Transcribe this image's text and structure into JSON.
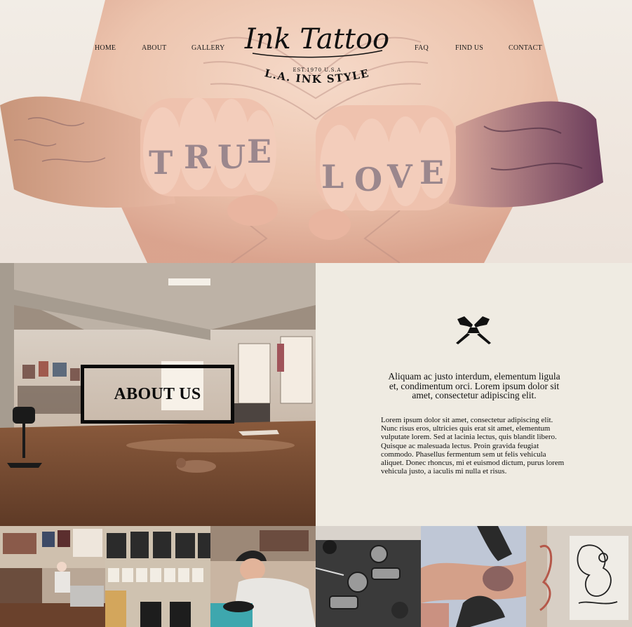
{
  "nav": {
    "left": [
      "HOME",
      "ABOUT",
      "GALLERY"
    ],
    "right": [
      "FAQ",
      "FIND US",
      "CONTACT"
    ]
  },
  "logo": {
    "script": "Ink Tattoo",
    "est": "EST.1970 U.S.A",
    "tagline": "L.A. INK STYLE"
  },
  "hero": {
    "knuckles_left": "TRUE",
    "knuckles_right": "LOVE"
  },
  "about": {
    "title": "ABOUT US",
    "icon": "tattoo-machines-icon",
    "lead": "Aliquam ac justo interdum, elementum ligula et, condimentum orci. Lorem ipsum dolor sit amet, consectetur adipiscing elit.",
    "paragraph1": "Lorem ipsum dolor sit amet, consectetur adipiscing elit. Nunc risus eros, ultricies quis erat sit amet, elementum vulputate lorem. Sed at lacinia lectus, quis blandit libero.",
    "paragraph2": "Quisque ac malesuada lectus. Proin gravida feugiat commodo. Phasellus fermentum sem ut felis vehicula aliquet. Donec rhoncus, mi et euismod dictum, purus lorem vehicula justo, a iaculis mi nulla et risus."
  },
  "colors": {
    "background": "#efebe2",
    "text": "#111111",
    "border": "#0a0a0a"
  },
  "gallery": [
    {
      "name": "studio-interior-photo"
    },
    {
      "name": "framed-art-wall-photo"
    },
    {
      "name": "tattoo-artist-working-photo"
    },
    {
      "name": "tattoo-machines-photo"
    },
    {
      "name": "tattooing-arm-photo"
    },
    {
      "name": "tattoo-sketches-photo"
    }
  ]
}
